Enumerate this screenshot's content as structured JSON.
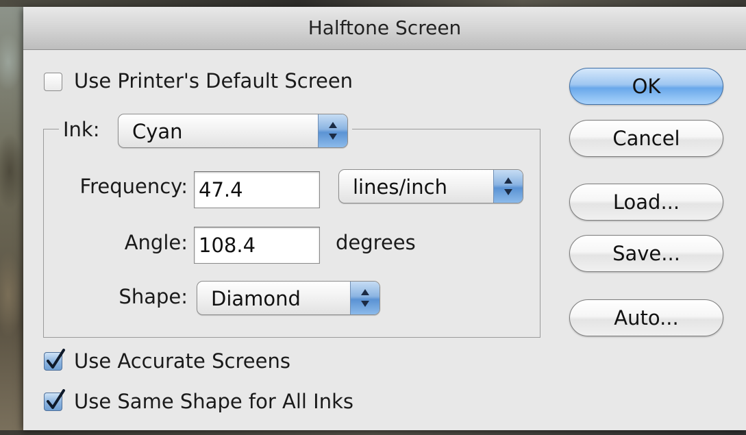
{
  "dialog": {
    "title": "Halftone Screen"
  },
  "options": {
    "use_printer_default": {
      "label": "Use Printer's Default Screen",
      "checked": false
    },
    "use_accurate_screens": {
      "label": "Use Accurate Screens",
      "checked": true
    },
    "use_same_shape": {
      "label": "Use Same Shape for All Inks",
      "checked": true
    }
  },
  "ink": {
    "label": "Ink:",
    "value": "Cyan"
  },
  "frequency": {
    "label": "Frequency:",
    "value": "47.4",
    "unit": "lines/inch"
  },
  "angle": {
    "label": "Angle:",
    "value": "108.4",
    "unit": "degrees"
  },
  "shape": {
    "label": "Shape:",
    "value": "Diamond"
  },
  "buttons": {
    "ok": "OK",
    "cancel": "Cancel",
    "load": "Load...",
    "save": "Save...",
    "auto": "Auto..."
  },
  "colors": {
    "accent": "#6aa8ea",
    "dialog_bg": "#e8e8e8"
  },
  "icons": {
    "popup_arrows": "up-down-arrows-icon",
    "check": "checkmark-icon"
  }
}
